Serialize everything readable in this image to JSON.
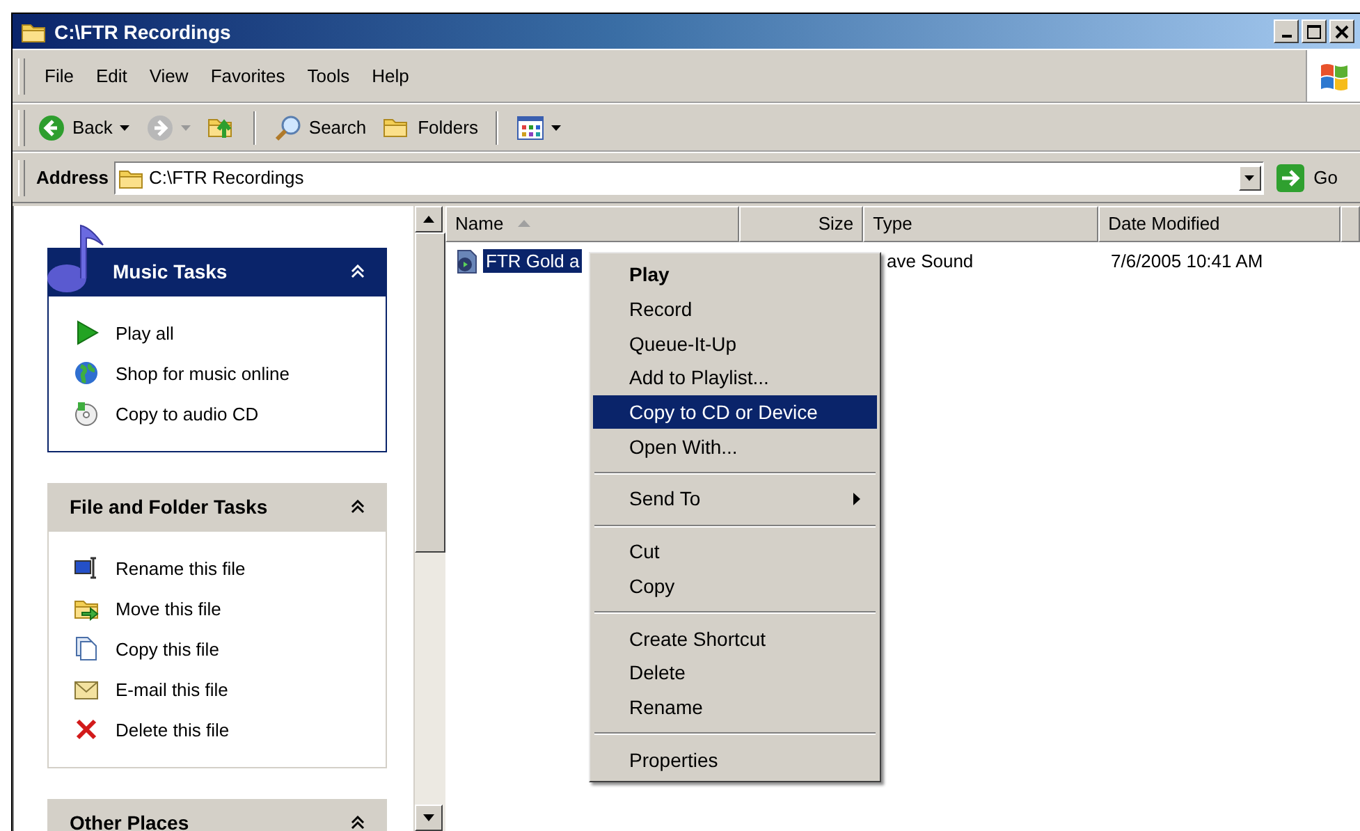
{
  "window": {
    "title": "C:\\FTR Recordings"
  },
  "menu_bar": [
    "File",
    "Edit",
    "View",
    "Favorites",
    "Tools",
    "Help"
  ],
  "toolbar": {
    "buttons": [
      {
        "kind": "back",
        "label": "Back",
        "disabled": false
      },
      {
        "kind": "forward",
        "disabled": true
      },
      {
        "kind": "up",
        "disabled": false
      },
      {
        "kind": "search",
        "label": "Search",
        "disabled": false
      },
      {
        "kind": "folders",
        "label": "Folders",
        "disabled": false
      },
      {
        "kind": "views",
        "disabled": false
      }
    ]
  },
  "address_bar": {
    "label": "Address",
    "value": "C:\\FTR Recordings",
    "go": "Go"
  },
  "task_panes": [
    {
      "title": "Music Tasks",
      "kind": "special",
      "expanded": true,
      "items": [
        {
          "kind": "play",
          "label": "Play all"
        },
        {
          "kind": "globe",
          "label": "Shop for music online"
        },
        {
          "kind": "cd",
          "label": "Copy to audio CD"
        }
      ]
    },
    {
      "title": "File and Folder Tasks",
      "kind": "normal",
      "expanded": true,
      "items": [
        {
          "kind": "rename",
          "label": "Rename this file"
        },
        {
          "kind": "move",
          "label": "Move this file"
        },
        {
          "kind": "copy",
          "label": "Copy this file"
        },
        {
          "kind": "email",
          "label": "E-mail this file"
        },
        {
          "kind": "delete",
          "label": "Delete this file"
        }
      ]
    },
    {
      "title": "Other Places",
      "kind": "normal",
      "expanded": true
    }
  ],
  "file_list": {
    "columns": [
      {
        "label": "Name",
        "sorted": true
      },
      {
        "label": "Size",
        "sorted": false
      },
      {
        "label": "Type",
        "sorted": false
      },
      {
        "label": "Date Modified",
        "sorted": false
      }
    ],
    "rows": [
      {
        "name": "FTR Gold a",
        "type": "ave Sound",
        "date_modified": "7/6/2005 10:41 AM",
        "selected": true
      }
    ]
  },
  "context_menu": {
    "items": [
      {
        "kind": "item",
        "label": "Play",
        "default": true,
        "selected": false,
        "submenu": false
      },
      {
        "kind": "item",
        "label": "Record",
        "default": false,
        "selected": false,
        "submenu": false
      },
      {
        "kind": "item",
        "label": "Queue-It-Up",
        "default": false,
        "selected": false,
        "submenu": false
      },
      {
        "kind": "item",
        "label": "Add to Playlist...",
        "default": false,
        "selected": false,
        "submenu": false
      },
      {
        "kind": "item",
        "label": "Copy to CD or Device",
        "default": false,
        "selected": true,
        "submenu": false
      },
      {
        "kind": "item",
        "label": "Open With...",
        "default": false,
        "selected": false,
        "submenu": false
      },
      {
        "kind": "separator"
      },
      {
        "kind": "item",
        "label": "Send To",
        "default": false,
        "selected": false,
        "submenu": true
      },
      {
        "kind": "separator"
      },
      {
        "kind": "item",
        "label": "Cut",
        "default": false,
        "selected": false,
        "submenu": false
      },
      {
        "kind": "item",
        "label": "Copy",
        "default": false,
        "selected": false,
        "submenu": false
      },
      {
        "kind": "separator"
      },
      {
        "kind": "item",
        "label": "Create Shortcut",
        "default": false,
        "selected": false,
        "submenu": false
      },
      {
        "kind": "item",
        "label": "Delete",
        "default": false,
        "selected": false,
        "submenu": false
      },
      {
        "kind": "item",
        "label": "Rename",
        "default": false,
        "selected": false,
        "submenu": false
      },
      {
        "kind": "separator"
      },
      {
        "kind": "item",
        "label": "Properties",
        "default": false,
        "selected": false,
        "submenu": false
      }
    ]
  }
}
